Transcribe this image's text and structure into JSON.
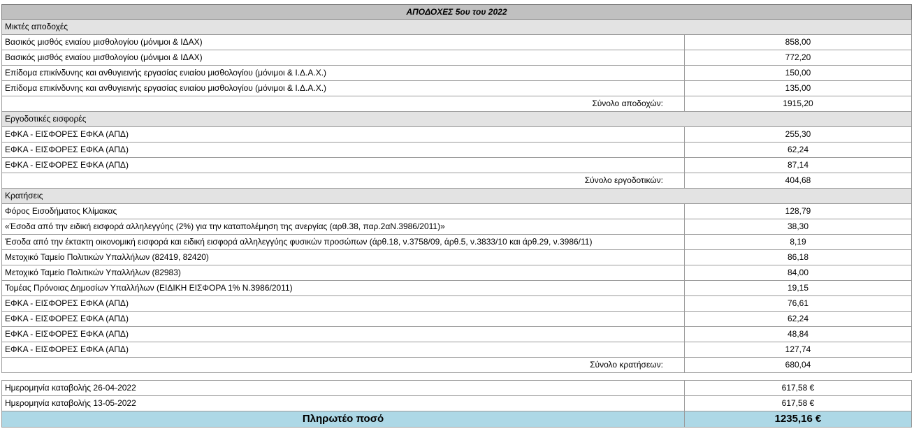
{
  "title": "ΑΠΟΔΟΧΕΣ 5ου του 2022",
  "sections": [
    {
      "header": "Μικτές αποδοχές",
      "rows": [
        {
          "label": "Βασικός μισθός ενιαίου μισθολογίου (μόνιμοι & ΙΔΑΧ)",
          "value": "858,00"
        },
        {
          "label": "Βασικός μισθός ενιαίου μισθολογίου (μόνιμοι & ΙΔΑΧ)",
          "value": "772,20"
        },
        {
          "label": "Επίδομα επικίνδυνης και ανθυγιεινής εργασίας ενιαίου μισθολογίου (μόνιμοι & Ι.Δ.Α.Χ.)",
          "value": "150,00"
        },
        {
          "label": "Επίδομα επικίνδυνης και ανθυγιεινής εργασίας ενιαίου μισθολογίου (μόνιμοι & Ι.Δ.Α.Χ.)",
          "value": "135,00"
        }
      ],
      "total_label": "Σύνολο αποδοχών:",
      "total_value": "1915,20"
    },
    {
      "header": "Εργοδοτικές εισφορές",
      "rows": [
        {
          "label": "ΕΦΚΑ - ΕΙΣΦΟΡΕΣ ΕΦΚΑ (ΑΠΔ)",
          "value": "255,30"
        },
        {
          "label": "ΕΦΚΑ - ΕΙΣΦΟΡΕΣ ΕΦΚΑ (ΑΠΔ)",
          "value": "62,24"
        },
        {
          "label": "ΕΦΚΑ - ΕΙΣΦΟΡΕΣ ΕΦΚΑ (ΑΠΔ)",
          "value": "87,14"
        }
      ],
      "total_label": "Σύνολο εργοδοτικών:",
      "total_value": "404,68"
    },
    {
      "header": "Κρατήσεις",
      "rows": [
        {
          "label": "Φόρος Εισοδήματος Κλίμακας",
          "value": "128,79"
        },
        {
          "label": "«Έσοδα από την ειδική εισφορά αλληλεγγύης (2%) για την καταπολέμηση της ανεργίας (αρθ.38, παρ.2αΝ.3986/2011)»",
          "value": "38,30"
        },
        {
          "label": "Έσοδα από την έκτακτη οικονομική εισφορά και ειδική εισφορά αλληλεγγύης φυσικών προσώπων (άρθ.18, ν.3758/09, άρθ.5, ν.3833/10 και άρθ.29, ν.3986/11)",
          "value": "8,19"
        },
        {
          "label": "Μετοχικό Ταμείο Πολιτικών Υπαλλήλων (82419, 82420)",
          "value": "86,18"
        },
        {
          "label": "Μετοχικό Ταμείο Πολιτικών Υπαλλήλων (82983)",
          "value": "84,00"
        },
        {
          "label": "Τομέας Πρόνοιας Δημοσίων Υπαλλήλων (ΕΙΔΙΚΗ ΕΙΣΦΟΡΑ 1% Ν.3986/2011)",
          "value": "19,15"
        },
        {
          "label": "ΕΦΚΑ - ΕΙΣΦΟΡΕΣ ΕΦΚΑ (ΑΠΔ)",
          "value": "76,61"
        },
        {
          "label": "ΕΦΚΑ - ΕΙΣΦΟΡΕΣ ΕΦΚΑ (ΑΠΔ)",
          "value": "62,24"
        },
        {
          "label": "ΕΦΚΑ - ΕΙΣΦΟΡΕΣ ΕΦΚΑ (ΑΠΔ)",
          "value": "48,84"
        },
        {
          "label": "ΕΦΚΑ - ΕΙΣΦΟΡΕΣ ΕΦΚΑ (ΑΠΔ)",
          "value": "127,74"
        }
      ],
      "total_label": "Σύνολο κρατήσεων:",
      "total_value": "680,04"
    }
  ],
  "payments": [
    {
      "label": "Ημερομηνία καταβολής 26-04-2022",
      "value": "617,58 €"
    },
    {
      "label": "Ημερομηνία καταβολής 13-05-2022",
      "value": "617,58 €"
    }
  ],
  "payable": {
    "label": "Πληρωτέο ποσό",
    "value": "1235,16 €"
  },
  "colors": {
    "title_bg": "#c0c0c0",
    "section_bg": "#e3e3e3",
    "total_bg": "#add8e6"
  }
}
